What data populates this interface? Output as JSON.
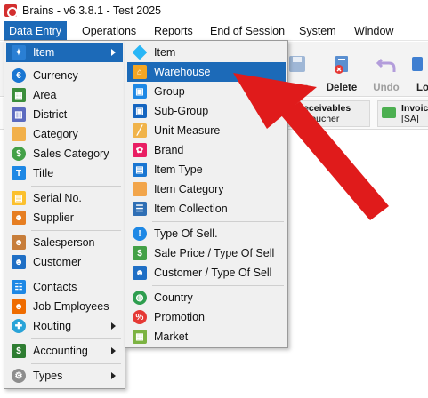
{
  "window": {
    "title": "Brains - v6.3.8.1 - Test 2025"
  },
  "menubar": [
    {
      "label": "Data Entry"
    },
    {
      "label": "Operations"
    },
    {
      "label": "Reports"
    },
    {
      "label": "End of Session"
    },
    {
      "label": "System"
    },
    {
      "label": "Window"
    }
  ],
  "toolbar": {
    "save": "Save",
    "delete": "Delete",
    "undo": "Undo",
    "partial": "Lo"
  },
  "ribbon": {
    "card1_line1": "& Receivables",
    "card1_line2": "eipt Voucher",
    "card2_line1": "Invoice",
    "card2_line2": "[SA] C"
  },
  "data_entry_menu": [
    {
      "label": "Item",
      "icon": "item-icon"
    },
    {
      "label": "Currency",
      "icon": "currency-icon"
    },
    {
      "label": "Area",
      "icon": "area-icon"
    },
    {
      "label": "District",
      "icon": "district-icon"
    },
    {
      "label": "Category",
      "icon": "folder-icon"
    },
    {
      "label": "Sales Category",
      "icon": "money-bag-icon"
    },
    {
      "label": "Title",
      "icon": "title-icon"
    },
    {
      "label": "Serial No.",
      "icon": "serial-icon"
    },
    {
      "label": "Supplier",
      "icon": "supplier-icon"
    },
    {
      "label": "Salesperson",
      "icon": "salesperson-icon"
    },
    {
      "label": "Customer",
      "icon": "customer-icon"
    },
    {
      "label": "Contacts",
      "icon": "contacts-icon"
    },
    {
      "label": "Job Employees",
      "icon": "employee-icon"
    },
    {
      "label": "Routing",
      "icon": "routing-icon"
    },
    {
      "label": "Accounting",
      "icon": "dollar-icon"
    },
    {
      "label": "Types",
      "icon": "gear-icon"
    }
  ],
  "item_submenu": [
    {
      "label": "Item",
      "icon": "diamond-icon"
    },
    {
      "label": "Warehouse",
      "icon": "warehouse-icon"
    },
    {
      "label": "Group",
      "icon": "group-icon"
    },
    {
      "label": "Sub-Group",
      "icon": "sub-group-icon"
    },
    {
      "label": "Unit Measure",
      "icon": "ruler-icon"
    },
    {
      "label": "Brand",
      "icon": "brand-icon"
    },
    {
      "label": "Item Type",
      "icon": "item-type-icon"
    },
    {
      "label": "Item Category",
      "icon": "folder-icon"
    },
    {
      "label": "Item Collection",
      "icon": "list-icon"
    },
    {
      "label": "Type Of Sell.",
      "icon": "type-of-sell-icon"
    },
    {
      "label": "Sale Price / Type Of Sell",
      "icon": "dollar-icon"
    },
    {
      "label": "Customer / Type Of Sell",
      "icon": "customer-icon"
    },
    {
      "label": "Country",
      "icon": "globe-icon"
    },
    {
      "label": "Promotion",
      "icon": "percent-icon"
    },
    {
      "label": "Market",
      "icon": "market-icon"
    }
  ],
  "colors": {
    "highlight": "#1c6ab8",
    "annotation_arrow": "#e01b1b"
  }
}
